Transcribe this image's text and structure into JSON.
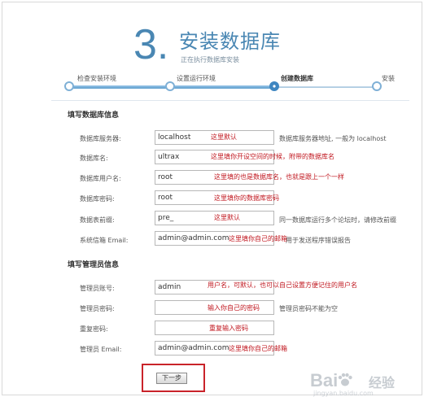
{
  "header": {
    "step_number": "3.",
    "title": "安装数据库",
    "subtitle": "正在执行数据库安装"
  },
  "progress": {
    "steps": [
      {
        "label": "检查安装环境",
        "state": "done"
      },
      {
        "label": "设置运行环境",
        "state": "done"
      },
      {
        "label": "创建数据库",
        "state": "current"
      },
      {
        "label": "安装",
        "state": "pending"
      }
    ]
  },
  "db_section": {
    "title": "填写数据库信息",
    "rows": [
      {
        "label": "数据库服务器:",
        "value": "localhost",
        "note": "这里默认",
        "help": "数据库服务器地址, 一般为 localhost"
      },
      {
        "label": "数据库名:",
        "value": "ultrax",
        "note": "这里填你开设空间的时候，附带的数据库名",
        "help": ""
      },
      {
        "label": "数据库用户名:",
        "value": "root",
        "note": "这里填的也是数据库名，也就是跟上一个一样",
        "help": ""
      },
      {
        "label": "数据库密码:",
        "value": "root",
        "note": "这里填你的数据库密码",
        "help": ""
      },
      {
        "label": "数据表前缀:",
        "value": "pre_",
        "note": "这里默认",
        "help": "同一数据库运行多个论坛时，请修改前缀"
      },
      {
        "label": "系统信箱 Email:",
        "value": "admin@admin.com",
        "note": "这里填你自己的邮箱",
        "help": "用于发送程序错误报告"
      }
    ]
  },
  "admin_section": {
    "title": "填写管理员信息",
    "rows": [
      {
        "label": "管理员账号:",
        "value": "admin",
        "note": "用户名，可默认，也可以自己设置方便记住的用户名",
        "help": ""
      },
      {
        "label": "管理员密码:",
        "value": "",
        "note": "输入你自己的密码",
        "help": "管理员密码不能为空"
      },
      {
        "label": "重复密码:",
        "value": "",
        "note": "重复输入密码",
        "help": ""
      },
      {
        "label": "管理员 Email:",
        "value": "admin@admin.com",
        "note": "这里填你自己的邮箱",
        "help": ""
      }
    ]
  },
  "actions": {
    "next_label": "下一步"
  },
  "watermark": {
    "logo": "Bai",
    "logo_icon": "paw-icon",
    "text": "经验",
    "url": "jingyan.baidu.com"
  },
  "colors": {
    "accent": "#4a87b3",
    "note_red": "#c0161e",
    "highlight_red": "#c9232a"
  }
}
